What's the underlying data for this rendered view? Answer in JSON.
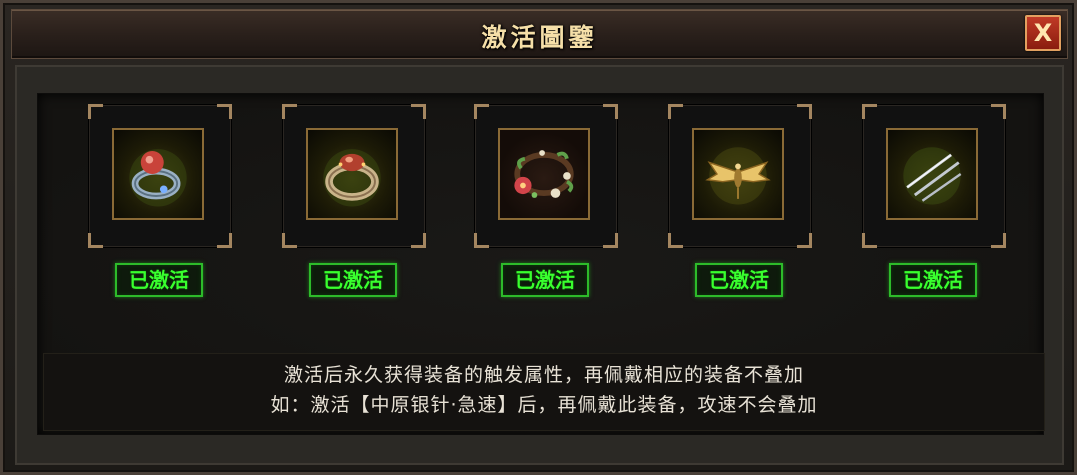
{
  "window": {
    "title": "激活圖鑒",
    "close_label": "X"
  },
  "items": [
    {
      "icon": "ring-with-red-gem-icon",
      "status": "已激活"
    },
    {
      "icon": "gold-ring-with-red-gem-icon",
      "status": "已激活"
    },
    {
      "icon": "flower-wreath-icon",
      "status": "已激活"
    },
    {
      "icon": "golden-bat-wings-icon",
      "status": "已激活"
    },
    {
      "icon": "silver-needles-icon",
      "status": "已激活"
    }
  ],
  "description": {
    "line1": "激活后永久获得装备的触发属性，再佩戴相应的装备不叠加",
    "line2": "如：激活【中原银针·急速】后，再佩戴此装备，攻速不会叠加"
  },
  "colors": {
    "active_green": "#39ff2e",
    "title_gold": "#f5dfa8",
    "close_red": "#c03a26"
  }
}
